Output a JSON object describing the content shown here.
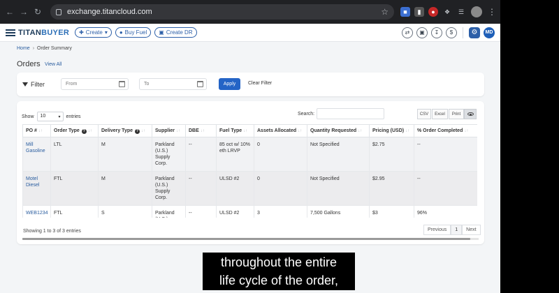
{
  "browser": {
    "url": "exchange.titancloud.com"
  },
  "header": {
    "logo_part1": "TITAN",
    "logo_part2": "BUYER",
    "create_label": "Create",
    "buy_fuel_label": "Buy Fuel",
    "create_dr_label": "Create DR",
    "user_initials": "MD"
  },
  "breadcrumb": {
    "home": "Home",
    "current": "Order Summary"
  },
  "page": {
    "title": "Orders",
    "view_all": "View All"
  },
  "filter": {
    "label": "Filter",
    "from_placeholder": "From",
    "to_placeholder": "To",
    "apply_label": "Apply",
    "clear_label": "Clear Filter"
  },
  "table_controls": {
    "show_label": "Show",
    "entries_value": "10",
    "entries_label": "entries",
    "search_label": "Search:",
    "csv_label": "CSV",
    "excel_label": "Excel",
    "print_label": "Print"
  },
  "table": {
    "columns": [
      "PO #",
      "Order Type",
      "Delivery Type",
      "Supplier",
      "DBE",
      "Fuel Type",
      "Assets Allocated",
      "Quantity Requested",
      "Pricing (USD)",
      "% Order Completed"
    ],
    "rows": [
      {
        "po": "Mill Gasoline",
        "order_type": "LTL",
        "delivery_type": "M",
        "supplier": "Parkland (U.S.) Supply Corp.",
        "dbe": "--",
        "fuel_type": "85 oct w/ 10% eth LRVP",
        "assets": "0",
        "quantity": "Not Specified",
        "pricing": "$2.75",
        "completed": "--"
      },
      {
        "po": "Motel Diesel",
        "order_type": "FTL",
        "delivery_type": "M",
        "supplier": "Parkland (U.S.) Supply Corp.",
        "dbe": "--",
        "fuel_type": "ULSD #2",
        "assets": "0",
        "quantity": "Not Specified",
        "pricing": "$2.95",
        "completed": "--"
      },
      {
        "po": "WEB1234",
        "order_type": "FTL",
        "delivery_type": "S",
        "supplier": "Parkland (U.S.) Supply Corp.",
        "dbe": "--",
        "fuel_type": "ULSD #2",
        "assets": "3",
        "quantity": "7,500 Gallons",
        "pricing": "$3",
        "completed": "96%"
      }
    ]
  },
  "footer": {
    "info": "Showing 1 to 3 of 3 entries",
    "previous": "Previous",
    "page": "1",
    "next": "Next"
  },
  "caption": {
    "line1": "throughout the entire",
    "line2": "life cycle of the order,"
  },
  "colors": {
    "brand_navy": "#1d3b5a",
    "brand_blue": "#2c6fb7",
    "link": "#2a5d9f",
    "apply": "#2464c6"
  }
}
